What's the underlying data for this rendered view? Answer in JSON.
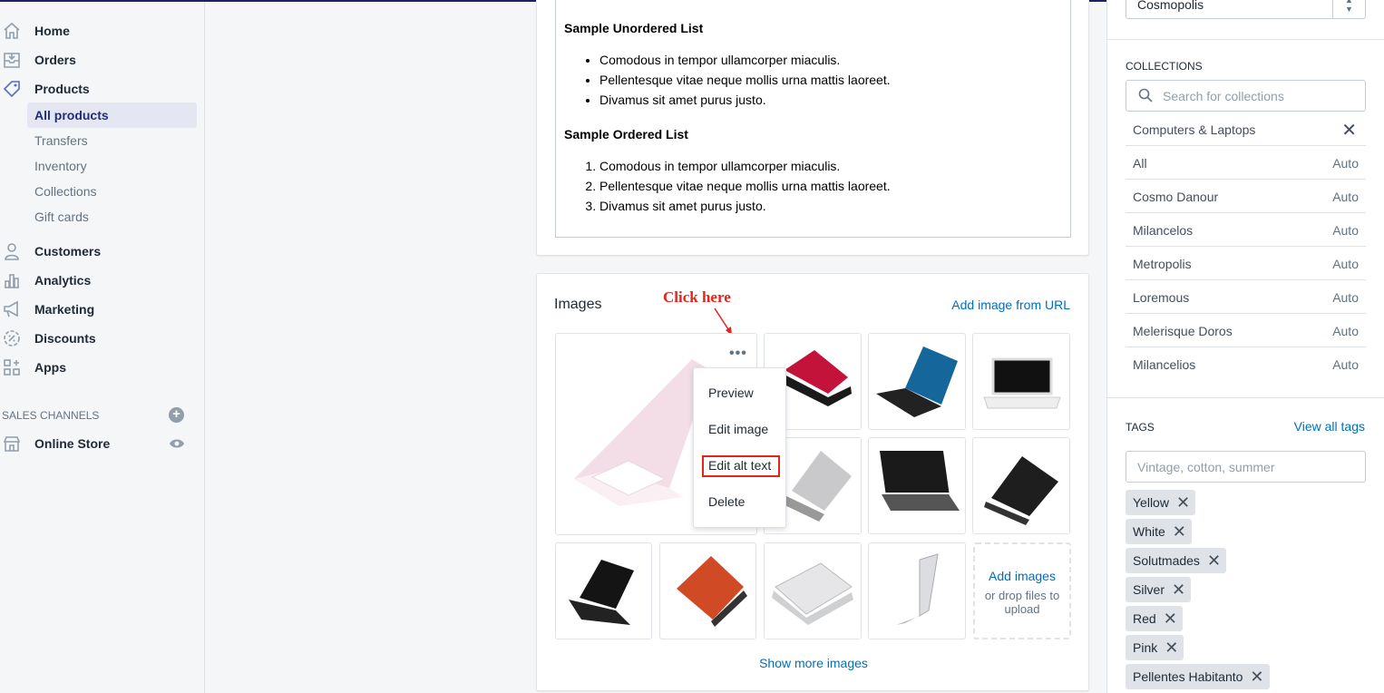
{
  "sidebar": {
    "nav": [
      {
        "label": "Home",
        "icon": "home-icon"
      },
      {
        "label": "Orders",
        "icon": "orders-icon"
      },
      {
        "label": "Products",
        "icon": "tag-icon"
      },
      {
        "label": "Customers",
        "icon": "person-icon"
      },
      {
        "label": "Analytics",
        "icon": "bar-chart-icon"
      },
      {
        "label": "Marketing",
        "icon": "megaphone-icon"
      },
      {
        "label": "Discounts",
        "icon": "discount-icon"
      },
      {
        "label": "Apps",
        "icon": "apps-icon"
      }
    ],
    "products_sub": [
      "All products",
      "Transfers",
      "Inventory",
      "Collections",
      "Gift cards"
    ],
    "sales_channels_label": "SALES CHANNELS",
    "online_store": "Online Store"
  },
  "description": {
    "ul_title": "Sample Unordered List",
    "ul_items": [
      "Comodous in tempor ullamcorper miaculis.",
      "Pellentesque vitae neque mollis urna mattis laoreet.",
      "Divamus sit amet purus justo."
    ],
    "ol_title": "Sample Ordered List",
    "ol_items": [
      "Comodous in tempor ullamcorper miaculis.",
      "Pellentesque vitae neque mollis urna mattis laoreet.",
      "Divamus sit amet purus justo."
    ]
  },
  "images": {
    "title": "Images",
    "add_from_url": "Add image from URL",
    "annotation": "Click here",
    "menu": [
      "Preview",
      "Edit image",
      "Edit alt text",
      "Delete"
    ],
    "add_images": "Add images",
    "drop_text": "or drop files to upload",
    "show_more": "Show more images",
    "more_icon": "more-horizontal-icon"
  },
  "right": {
    "vendor_value": "Cosmopolis",
    "collections_label": "COLLECTIONS",
    "collections_placeholder": "Search for collections",
    "selected_collection": "Computers & Laptops",
    "collections": [
      {
        "name": "All",
        "type": "Auto"
      },
      {
        "name": "Cosmo Danour",
        "type": "Auto"
      },
      {
        "name": "Milancelos",
        "type": "Auto"
      },
      {
        "name": "Metropolis",
        "type": "Auto"
      },
      {
        "name": "Loremous",
        "type": "Auto"
      },
      {
        "name": "Melerisque Doros",
        "type": "Auto"
      },
      {
        "name": "Milancelios",
        "type": "Auto"
      }
    ],
    "tags_label": "TAGS",
    "view_all_tags": "View all tags",
    "tags_placeholder": "Vintage, cotton, summer",
    "tags": [
      "Yellow",
      "White",
      "Solutmades",
      "Silver",
      "Red",
      "Pink",
      "Pellentes Habitanto"
    ]
  },
  "colors": {
    "accent": "#006fbb",
    "annotation_red": "#e1251b",
    "active_nav": "#202e78"
  }
}
